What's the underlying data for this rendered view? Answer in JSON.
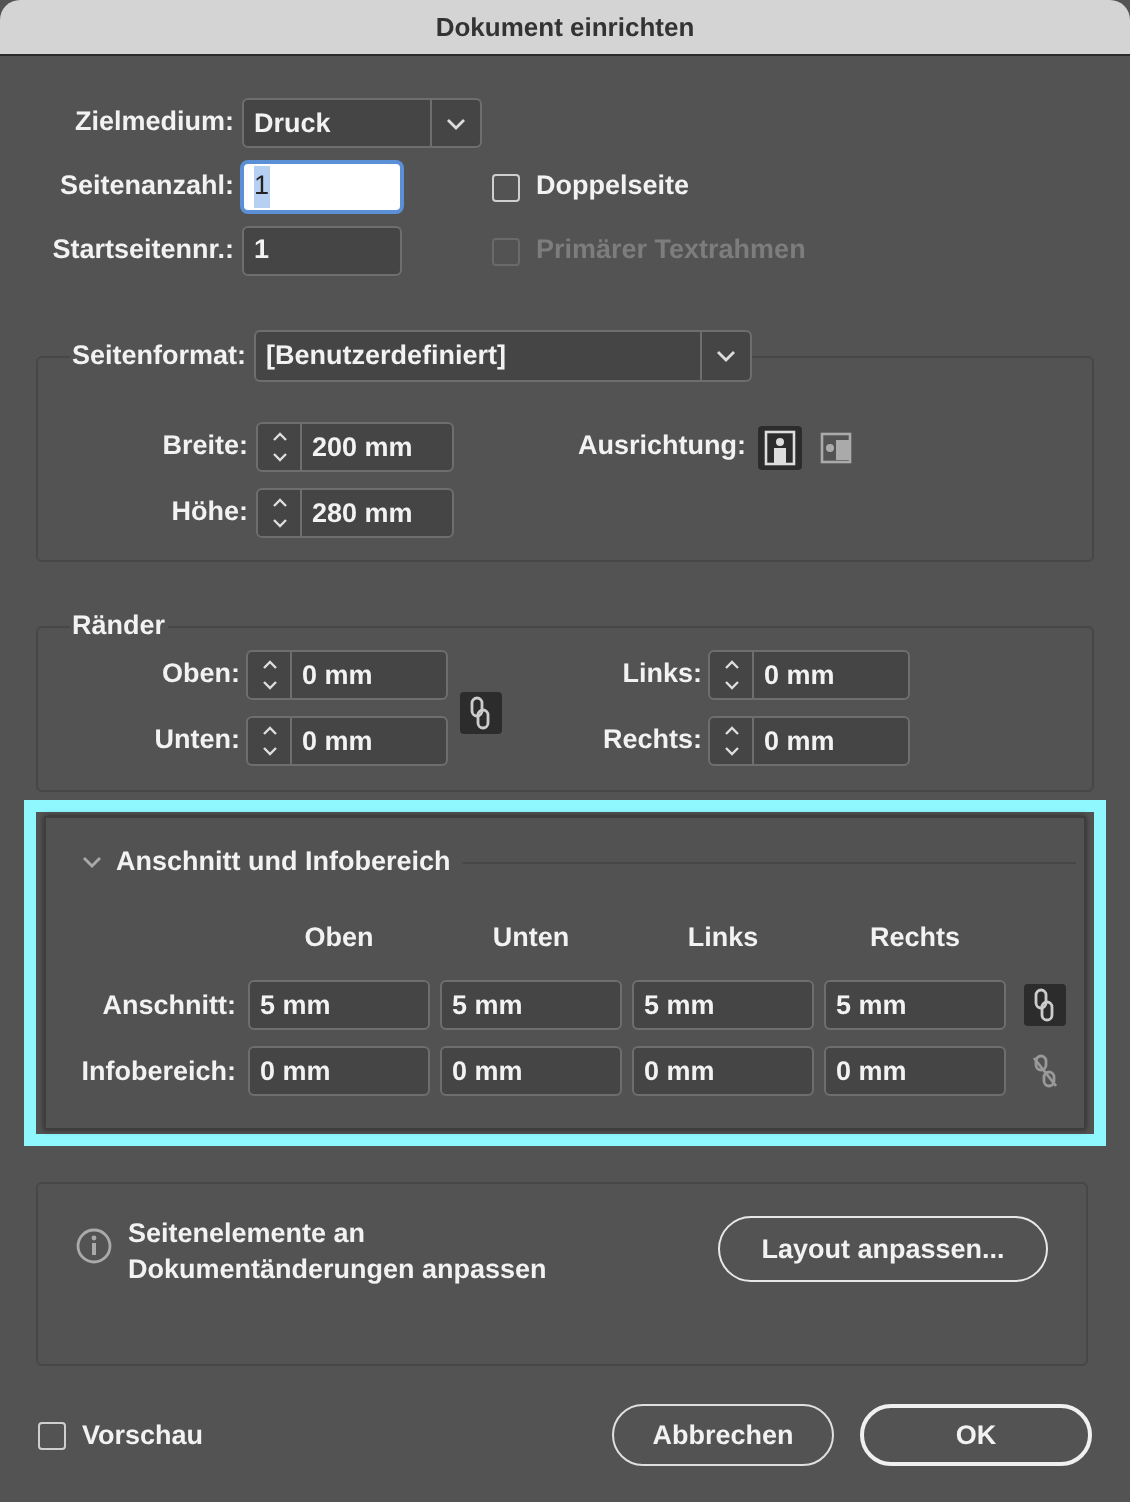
{
  "window": {
    "title": "Dokument einrichten"
  },
  "general": {
    "fields": [
      {
        "label": "Zielmedium:",
        "kind": "dropdown",
        "value": "Druck"
      },
      {
        "label": "Seitenanzahl:",
        "kind": "input",
        "value": "1",
        "focused": true
      },
      {
        "label": "Startseitennr.:",
        "kind": "input",
        "value": "1",
        "focused": false
      }
    ],
    "options": [
      {
        "label": "Doppelseite",
        "checked": false,
        "disabled": false
      },
      {
        "label": "Primärer Textrahmen",
        "checked": false,
        "disabled": true
      }
    ]
  },
  "page_format": {
    "label": "Seitenformat:",
    "value": "[Benutzerdefiniert]",
    "fields": [
      {
        "label": "Breite:",
        "value": "200 mm"
      },
      {
        "label": "Höhe:",
        "value": "280 mm"
      }
    ],
    "orientation": {
      "label": "Ausrichtung:",
      "options": [
        {
          "kind": "portrait",
          "selected": true
        },
        {
          "kind": "landscape",
          "selected": false
        }
      ]
    }
  },
  "margins": {
    "title": "Ränder",
    "linked": true,
    "left_fields": [
      {
        "label": "Oben:",
        "value": "0 mm"
      },
      {
        "label": "Unten:",
        "value": "0 mm"
      }
    ],
    "right_fields": [
      {
        "label": "Links:",
        "value": "0 mm"
      },
      {
        "label": "Rechts:",
        "value": "0 mm"
      }
    ]
  },
  "bleed": {
    "title": "Anschnitt und Infobereich",
    "expanded": true,
    "highlighted": true,
    "columns": [
      "Oben",
      "Unten",
      "Links",
      "Rechts"
    ],
    "rows": [
      {
        "label": "Anschnitt:",
        "values": [
          "5 mm",
          "5 mm",
          "5 mm",
          "5 mm"
        ],
        "linked": true
      },
      {
        "label": "Infobereich:",
        "values": [
          "0 mm",
          "0 mm",
          "0 mm",
          "0 mm"
        ],
        "linked": false
      }
    ]
  },
  "adjust": {
    "text": "Seitenelemente an Dokumentänderungen anpassen",
    "button": "Layout anpassen..."
  },
  "preview": {
    "label": "Vorschau",
    "checked": false
  },
  "buttons": [
    {
      "label": "Abbrechen",
      "default": false
    },
    {
      "label": "OK",
      "default": true
    }
  ]
}
